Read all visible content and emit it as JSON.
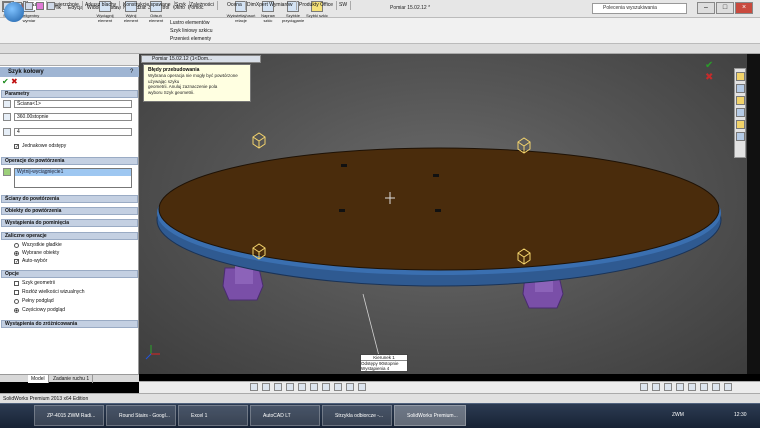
{
  "titlebar": {
    "logo": "SOLIDWORKS",
    "menus": [
      "Plik",
      "Edycja",
      "Widok",
      "Wstaw",
      "Narzędzia",
      "3Dcontrol",
      "Okno",
      "Pomoc"
    ],
    "document": "Pomiar 15.02.12 *",
    "help_placeholder": "Polecenia wyszukiwania"
  },
  "commands": [
    {
      "label": "Szkic"
    },
    {
      "label": "Inteligentny wymiar"
    },
    {
      "label": "Wyciągnij element"
    },
    {
      "label": "Wytnij element"
    },
    {
      "label": "Odsuń element"
    },
    {
      "label": "Wyświetlaj/usuń relacje"
    },
    {
      "label": "Napraw szkic"
    },
    {
      "label": "Szybkie przyciąganie"
    },
    {
      "label": "Szybki szkic"
    }
  ],
  "command_lines": [
    "Lustro elementów",
    "Szyk liniowy szkicu",
    "Przenieś elementy"
  ],
  "tabs": [
    "Operacje",
    "Szkic",
    "Powierzchnie",
    "Arkusz blachy",
    "Konstrukcje spawane",
    "Szyk",
    "Zależności",
    "Ocena",
    "DimXpert Wymiarów",
    "Produkty Office",
    "SW"
  ],
  "tab_active": "Szkic",
  "property": {
    "title": "Szyk kołowy",
    "sections": {
      "params": "Parametry",
      "ops": "Operacje do powtórzenia",
      "faces": "Ściany do powtórzenia",
      "bodies": "Obiekty do powtórzenia",
      "skip": "Wystąpienia do pominięcia",
      "opts": "Zaliczne operacje",
      "more": "Opcje",
      "vary": "Wystąpienia do zróżnicowania"
    },
    "axis_value": "Ściana<1>",
    "angle_value": "360.00stopnie",
    "count_value": "4",
    "equal_label": "Jednakowe odstępy",
    "selected_feature": "Wytnij-wyciągnięcie1",
    "radio_1": "Wszystkie gładkie",
    "radio_2": "Wybrane obiekty",
    "check_auto": "Auto-wybór",
    "opt_1": "Szyk geometrii",
    "opt_2": "Rozłóż wielkości wizualnych",
    "opt_3": "Pełny podgląd",
    "opt_4": "Częściowy podgląd"
  },
  "bottom_tabs": [
    "Model",
    "Zadanie ruchu 1"
  ],
  "viewport": {
    "breadcrumb": "Pomiar 15.02.12 (1<Dom...",
    "error_title": "Błędy przebudowania",
    "error_text": [
      "Wybrana operacja nie mogły być powtórzone używając szyku",
      "geometrii. Anuluj zaznaczenie pola",
      "wyboru Szyk geometrii."
    ]
  },
  "note": {
    "title": "Kierunek 1",
    "row1_label": "Odstępy",
    "row1_value": "90stopnie",
    "row2_label": "Wystąpienia",
    "row2_value": "4"
  },
  "status": "SolidWorks Premium 2013 x64 Edition",
  "taskbar": {
    "tasks": [
      "ZP-4015 ZWM Radi...",
      "Round Stairs - Googl...",
      "Excel 1",
      "AutoCAD LT",
      "Strzykla odbiorcze -...",
      "SolidWorks Premium..."
    ],
    "active_task": "SolidWorks Premium...",
    "tray_label": "ZWM",
    "clock": "12:30"
  },
  "colors": {
    "plate_top": "#4a2c0c",
    "plate_edge": "#3a6fb0",
    "support": "#7a4fa8",
    "accent": "#c4141a"
  }
}
